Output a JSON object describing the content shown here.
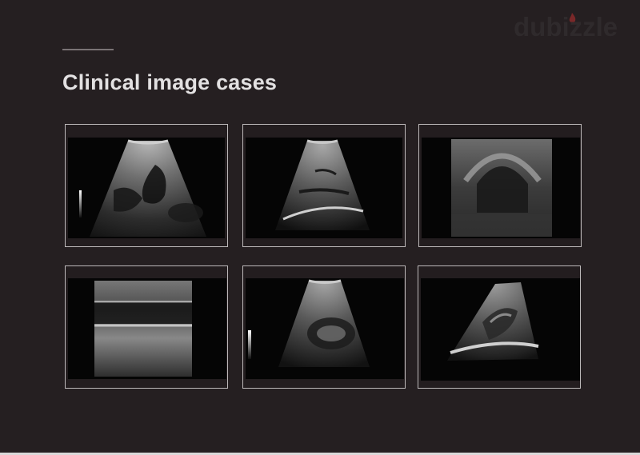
{
  "slide": {
    "title": "Clinical image cases"
  },
  "watermark": {
    "brand": "dubizzle",
    "icon": "flame-icon",
    "color": "#2f2a2c",
    "icon_color": "#8a2a2a"
  },
  "colors": {
    "background": "#251f21",
    "title": "#e3e1e2",
    "card_border": "#bdb9ba",
    "image_black": "#050505"
  },
  "cases": [
    {
      "kind": "liver-gallbladder-ultrasound",
      "has_gray_scale_bar": true
    },
    {
      "kind": "liver-ultrasound",
      "has_gray_scale_bar": false
    },
    {
      "kind": "linear-probe-ultrasound",
      "has_gray_scale_bar": false
    },
    {
      "kind": "vascular-linear-ultrasound",
      "has_gray_scale_bar": false
    },
    {
      "kind": "liver-kidney-ultrasound",
      "has_gray_scale_bar": true
    },
    {
      "kind": "kidney-ultrasound",
      "has_gray_scale_bar": false
    }
  ]
}
